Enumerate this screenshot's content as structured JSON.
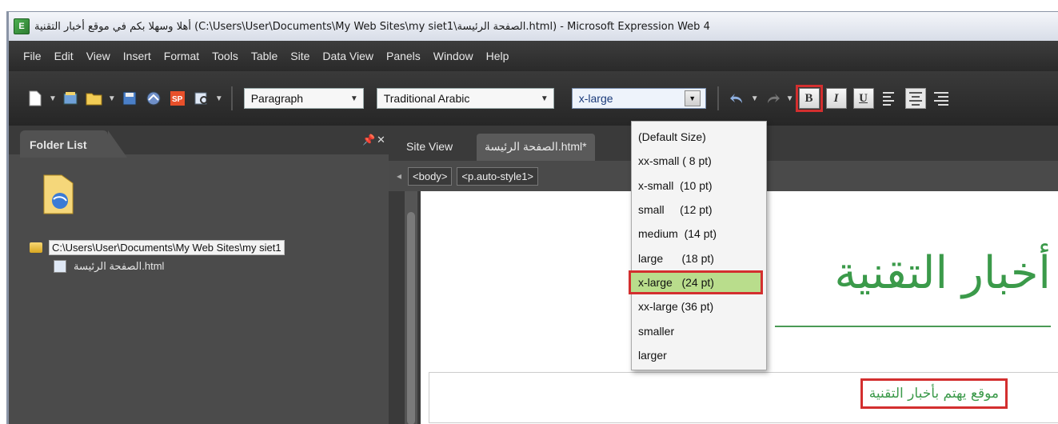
{
  "window": {
    "title": "أهلا وسهلا بكم في موقع أخبار التقنية (C:\\Users\\User\\Documents\\My Web Sites\\my siet1\\الصفحة الرئيسة.html) - Microsoft Expression Web 4"
  },
  "menu": [
    {
      "label": "File"
    },
    {
      "label": "Edit"
    },
    {
      "label": "View"
    },
    {
      "label": "Insert"
    },
    {
      "label": "Format"
    },
    {
      "label": "Tools"
    },
    {
      "label": "Table"
    },
    {
      "label": "Site"
    },
    {
      "label": "Data View"
    },
    {
      "label": "Panels"
    },
    {
      "label": "Window"
    },
    {
      "label": "Help"
    }
  ],
  "toolbar": {
    "style_combo": "Paragraph",
    "font_combo": "Traditional Arabic",
    "size_combo": "x-large",
    "bold": "B",
    "italic": "I",
    "underline": "U"
  },
  "size_dropdown": {
    "options": [
      "(Default Size)",
      "xx-small ( 8 pt)",
      "x-small  (10 pt)",
      "small     (12 pt)",
      "medium  (14 pt)",
      "large      (18 pt)",
      "x-large   (24 pt)",
      "xx-large (36 pt)",
      "smaller",
      "larger"
    ],
    "selected_index": 6
  },
  "folder_panel": {
    "title": "Folder List",
    "root_path": "C:\\Users\\User\\Documents\\My Web Sites\\my siet1",
    "file": "الصفحة الرئيسة.html"
  },
  "editor": {
    "tabs": [
      "Site View",
      "الصفحة الرئيسة.html*"
    ],
    "tag_chips": [
      "<body>",
      "<p.auto-style1>"
    ],
    "heading": "أخبار التقنية",
    "subheading": "موقع يهتم بأخبار التقنية"
  },
  "colors": {
    "accent_green": "#3b9a4a",
    "highlight_red": "#d32f2f",
    "selection_green": "#b9dd8c"
  }
}
